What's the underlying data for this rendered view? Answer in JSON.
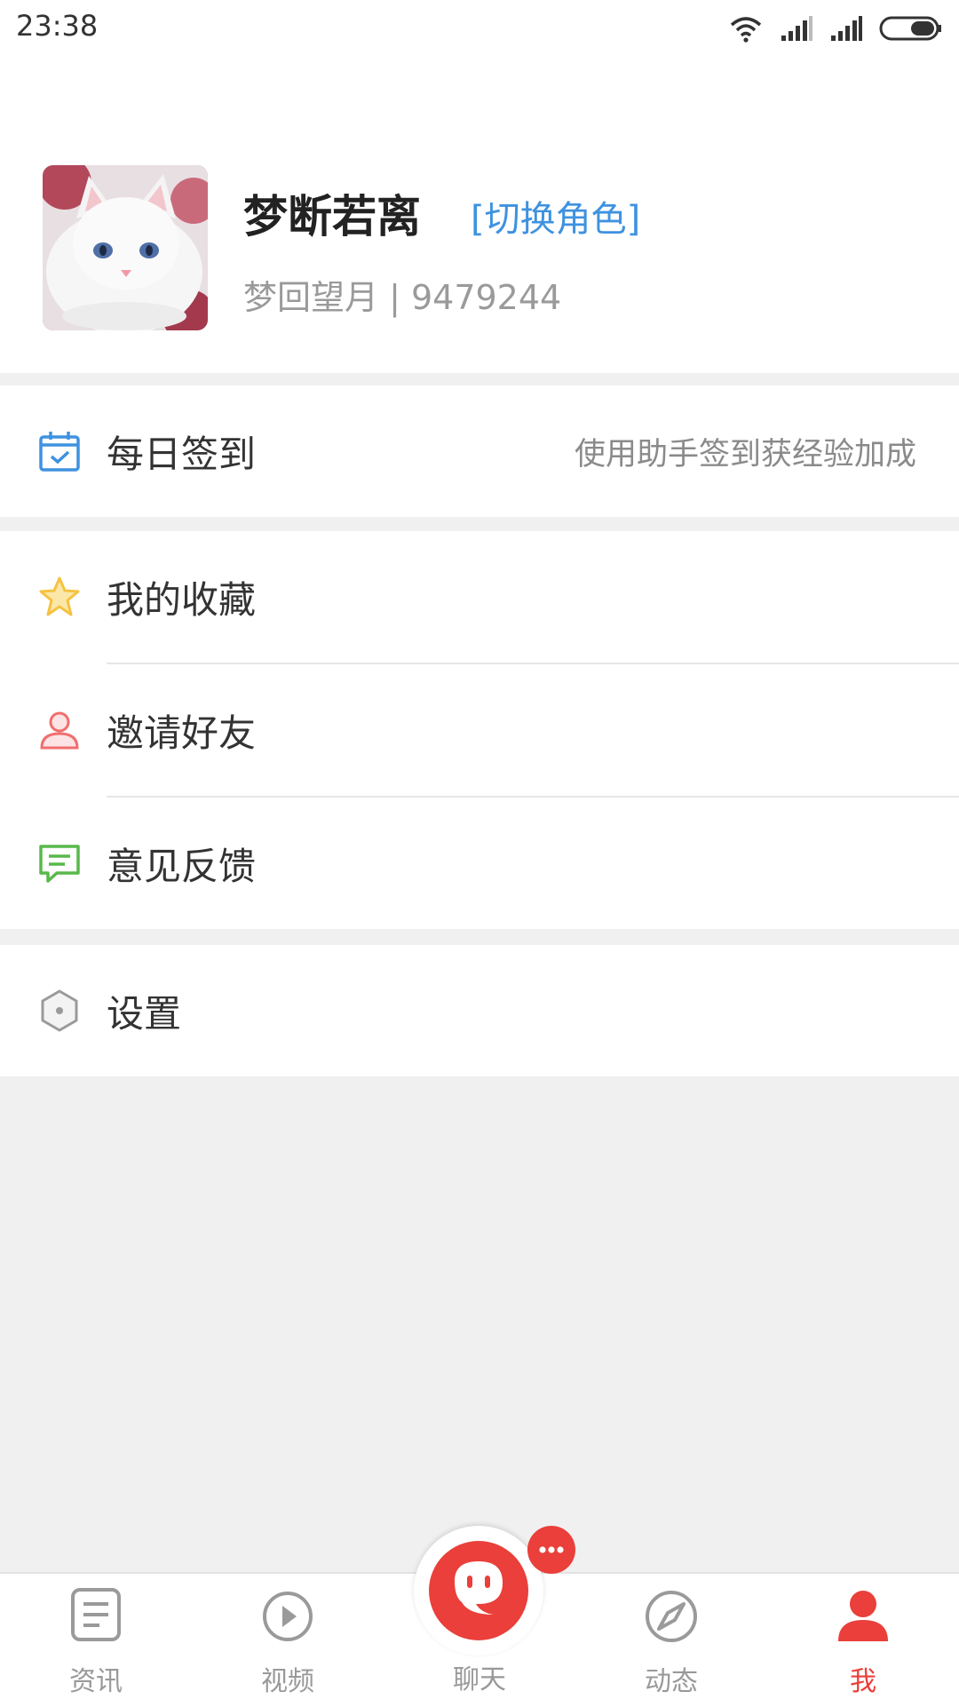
{
  "status_bar": {
    "time": "23:38",
    "icons": [
      "wifi-icon",
      "signal-icon",
      "signal-icon",
      "battery-icon"
    ]
  },
  "profile": {
    "name": "梦断若离",
    "switch_role": "[切换角色]",
    "subinfo": "梦回望月 | 9479244"
  },
  "menu": {
    "checkin": {
      "label": "每日签到",
      "hint": "使用助手签到获经验加成",
      "icon": "calendar-check-icon",
      "color": "#3e92e0"
    },
    "favorites": {
      "label": "我的收藏",
      "icon": "star-icon",
      "color": "#f5c242"
    },
    "invite": {
      "label": "邀请好友",
      "icon": "user-icon",
      "color": "#f06e6e"
    },
    "feedback": {
      "label": "意见反馈",
      "icon": "message-icon",
      "color": "#58b94a"
    },
    "settings": {
      "label": "设置",
      "icon": "hexagon-settings-icon",
      "color": "#9a9a9a"
    }
  },
  "tabs": [
    {
      "label": "资讯",
      "icon": "news-icon",
      "active": false
    },
    {
      "label": "视频",
      "icon": "play-icon",
      "active": false
    },
    {
      "label": "聊天",
      "icon": "chat-icon",
      "active": false
    },
    {
      "label": "动态",
      "icon": "compass-icon",
      "active": false
    },
    {
      "label": "我",
      "icon": "person-icon",
      "active": true
    }
  ],
  "colors": {
    "accent": "#ea3f3a",
    "link": "#3e92e0",
    "background": "#f0f0f0"
  }
}
